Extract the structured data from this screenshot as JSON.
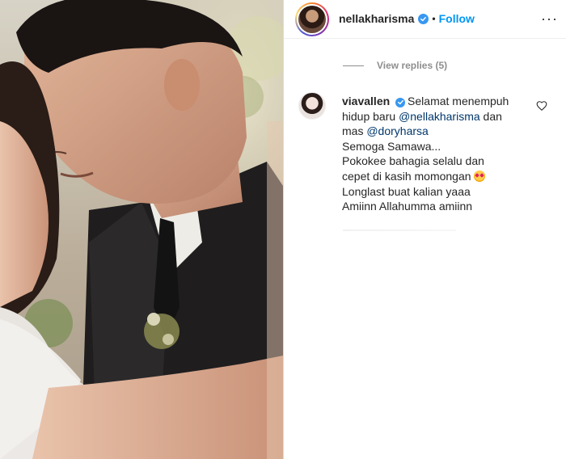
{
  "post": {
    "author": {
      "username": "nellakharisma",
      "verified": true,
      "follow_label": "Follow",
      "separator": "•",
      "more_label": "···"
    },
    "media": {
      "alt": "wedding photo"
    }
  },
  "replies": {
    "label": "View replies (5)"
  },
  "comment": {
    "username": "viavallen",
    "verified": true,
    "lines": [
      {
        "text": "Selamat menempuh"
      },
      {
        "text_before": "hidup baru ",
        "mention": "@nellakharisma",
        "text_after": " dan"
      },
      {
        "text_before": "mas ",
        "mention": "@doryharsa",
        "text_after": ""
      },
      {
        "text": "Semoga Samawa..."
      },
      {
        "text": "Pokokee bahagia selalu dan"
      },
      {
        "text": "cepet di kasih momongan"
      },
      {
        "text": "Longlast buat kalian yaaa"
      },
      {
        "text": "Amiinn Allahumma amiinn"
      }
    ],
    "emoji_name": "heart-eyes-face-icon"
  },
  "colors": {
    "link_blue": "#0095f6",
    "verified_blue": "#3897f0",
    "mention_blue": "#00376b",
    "muted_gray": "#8e8e8e",
    "text_dark": "#262626"
  }
}
